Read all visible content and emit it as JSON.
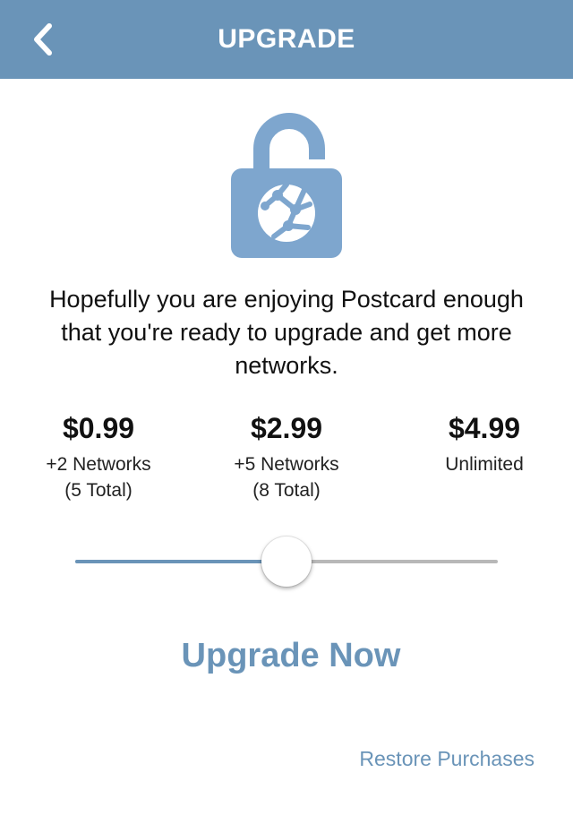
{
  "header": {
    "title": "UPGRADE",
    "back_icon": "chevron-left-icon",
    "background_color": "#6a94b8"
  },
  "hero": {
    "icon": "unlocked-padlock-globe-icon",
    "icon_color": "#7ea6ce"
  },
  "message": "Hopefully you are enjoying Postcard enough that you're ready to upgrade and get more networks.",
  "tiers": [
    {
      "price": "$0.99",
      "line1": "+2 Networks",
      "line2": "(5 Total)"
    },
    {
      "price": "$2.99",
      "line1": "+5 Networks",
      "line2": "(8 Total)"
    },
    {
      "price": "$4.99",
      "line1": "Unlimited",
      "line2": ""
    }
  ],
  "slider": {
    "selected_index": 1,
    "stops": 3,
    "fill_color": "#6a94b8",
    "track_color": "#b8b8b8"
  },
  "upgrade_button_label": "Upgrade Now",
  "restore_link_label": "Restore Purchases",
  "accent_color": "#6a94b8"
}
